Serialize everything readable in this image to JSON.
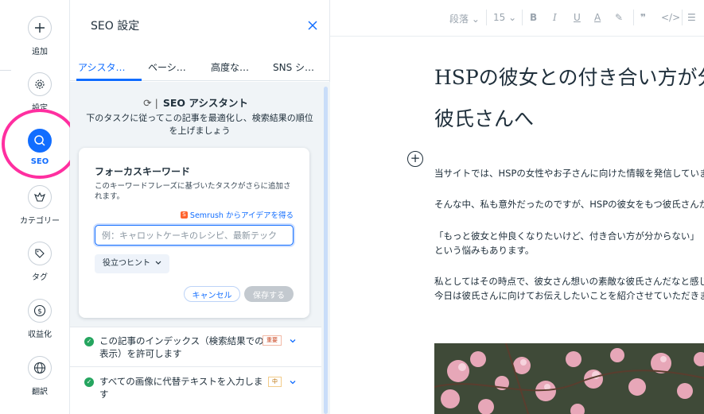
{
  "rail": {
    "items": [
      {
        "label": "追加",
        "icon": "plus-icon"
      },
      {
        "label": "設定",
        "icon": "gear-icon"
      },
      {
        "label": "SEO",
        "icon": "search-icon",
        "active": true
      },
      {
        "label": "カテゴリー",
        "icon": "category-icon"
      },
      {
        "label": "タグ",
        "icon": "tag-icon"
      },
      {
        "label": "収益化",
        "icon": "dollar-icon"
      },
      {
        "label": "翻訳",
        "icon": "globe-icon"
      }
    ],
    "highlight_color": "#ff2fa0",
    "accent": "#116dff"
  },
  "panel": {
    "title": "SEO 設定",
    "tabs": [
      "アシスタ…",
      "ベーシ…",
      "高度な…",
      "SNS シ…"
    ],
    "assistant_title": "SEO アシスタント",
    "assistant_desc": "下のタスクに従ってこの記事を最適化し、検索結果の順位を上げましょう",
    "focus": {
      "title": "フォーカスキーワード",
      "desc": "このキーワードフレーズに基づいたタスクがさらに追加されます。",
      "semrush": "Semrush からアイデアを得る",
      "placeholder": "例：キャロットケーキのレシピ、最新テック",
      "hint": "役立つヒント",
      "cancel": "キャンセル",
      "save": "保存する"
    },
    "tasks": [
      {
        "text": "この記事のインデックス（検索結果での表示）を許可します",
        "badge": "重要"
      },
      {
        "text": "すべての画像に代替テキストを入力します",
        "badge": "中"
      }
    ]
  },
  "editor": {
    "toolbar": {
      "style": "段落",
      "size": "15"
    },
    "title": "HSPの彼女との付き合い方が分からない彼氏さんへ",
    "paragraphs": [
      "当サイトでは、HSPの女性やお子さんに向けた情報を発信しています。",
      "そんな中、私も意外だったのですが、HSPの彼女をもつ彼氏さんからの相談もあります。",
      "「もっと彼女と仲良くなりたいけど、付き合い方が分からない」という悩みもあります。",
      "私としてはその時点で、彼女さん想いの素敵な彼氏さんだなと感じました。",
      "今日は彼氏さんに向けてお伝えしたいことを紹介させていただきます。"
    ]
  }
}
